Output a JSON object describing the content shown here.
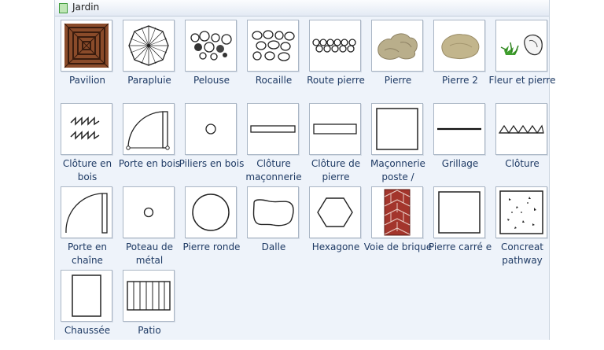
{
  "panel": {
    "title": "Jardin"
  },
  "shapes": [
    {
      "label": "Pavilion",
      "icon": "pavilion-icon"
    },
    {
      "label": "Parapluie",
      "icon": "umbrella-icon"
    },
    {
      "label": "Pelouse",
      "icon": "lawn-icon"
    },
    {
      "label": "Rocaille",
      "icon": "rockery-icon"
    },
    {
      "label": "Route pierre",
      "icon": "stone-path-icon"
    },
    {
      "label": "Pierre",
      "icon": "stone-icon"
    },
    {
      "label": "Pierre 2",
      "icon": "stone-2-icon"
    },
    {
      "label": "Fleur et pierre",
      "icon": "flower-stone-icon"
    },
    {
      "label": "Clôture en bois",
      "icon": "wood-fence-icon"
    },
    {
      "label": "Porte en bois",
      "icon": "wood-door-icon"
    },
    {
      "label": "Piliers en bois",
      "icon": "wood-pillar-icon"
    },
    {
      "label": "Clôture maçonnerie",
      "icon": "masonry-fence-icon"
    },
    {
      "label": "Clôture de pierre",
      "icon": "stone-fence-icon"
    },
    {
      "label": "Maçonnerie poste /",
      "icon": "masonry-post-icon"
    },
    {
      "label": "Grillage",
      "icon": "wire-fence-icon"
    },
    {
      "label": "Clôture",
      "icon": "fence-icon"
    },
    {
      "label": "Porte en chaîne",
      "icon": "chain-door-icon"
    },
    {
      "label": "Poteau de métal",
      "icon": "metal-post-icon"
    },
    {
      "label": "Pierre ronde",
      "icon": "round-stone-icon"
    },
    {
      "label": "Dalle",
      "icon": "slab-icon"
    },
    {
      "label": "Hexagone",
      "icon": "hexagon-icon"
    },
    {
      "label": "Voie de brique",
      "icon": "brick-path-icon"
    },
    {
      "label": "Pierre carré e",
      "icon": "square-stone-icon"
    },
    {
      "label": "Concreat pathway",
      "icon": "concrete-pathway-icon"
    },
    {
      "label": "Chaussée",
      "icon": "pavement-icon"
    },
    {
      "label": "Patio",
      "icon": "patio-icon"
    }
  ]
}
